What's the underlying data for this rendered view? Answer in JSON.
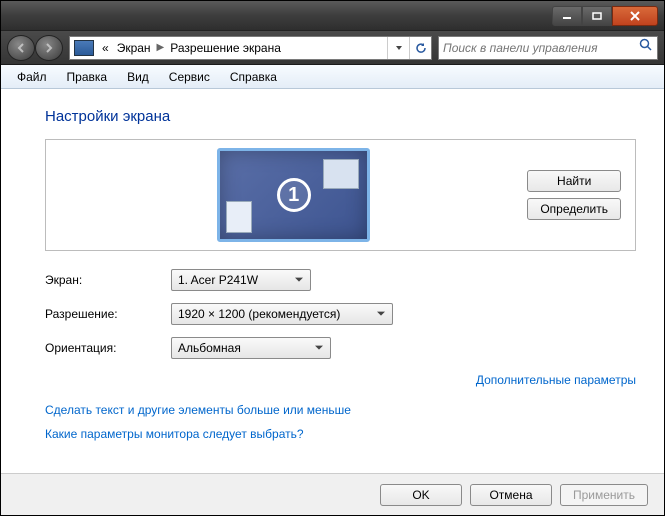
{
  "breadcrumb": {
    "root": "«",
    "seg1": "Экран",
    "seg2": "Разрешение экрана"
  },
  "search": {
    "placeholder": "Поиск в панели управления"
  },
  "menu": {
    "file": "Файл",
    "edit": "Правка",
    "view": "Вид",
    "tools": "Сервис",
    "help": "Справка"
  },
  "page_title": "Настройки экрана",
  "monitor_number": "1",
  "buttons": {
    "find": "Найти",
    "identify": "Определить",
    "ok": "OK",
    "cancel": "Отмена",
    "apply": "Применить"
  },
  "labels": {
    "screen": "Экран:",
    "resolution": "Разрешение:",
    "orientation": "Ориентация:"
  },
  "values": {
    "screen": "1. Acer P241W",
    "resolution": "1920 × 1200 (рекомендуется)",
    "orientation": "Альбомная"
  },
  "links": {
    "advanced": "Дополнительные параметры",
    "textsize": "Сделать текст и другие элементы больше или меньше",
    "which": "Какие параметры монитора следует выбрать?"
  }
}
